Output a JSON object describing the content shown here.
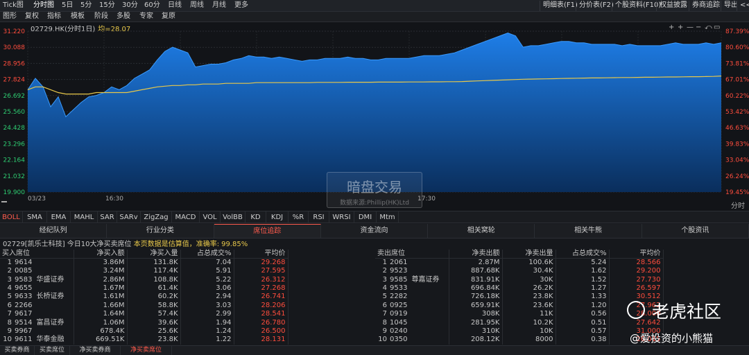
{
  "toolbar1": {
    "tick_label": "Tick图",
    "periods": [
      "分时图",
      "5日",
      "5分",
      "15分",
      "30分",
      "60分",
      "日线",
      "周线",
      "月线",
      "更多"
    ],
    "right_buttons": [
      "明细表(F1)",
      "分价表(F2)",
      "个股资料(F10)",
      "权益披露",
      "券商追踪",
      "导出",
      "<<"
    ]
  },
  "toolbar2": {
    "items": [
      "图形",
      "复权",
      "指标",
      "模板",
      "阶段",
      "多股",
      "专家",
      "复原"
    ]
  },
  "chart": {
    "title": "02729.HK(分时1日)",
    "avg_label": "均=28.07",
    "unit_label": "分时",
    "time_labels": [
      "03/23",
      "16:30",
      "17:30"
    ],
    "chart_data": {
      "type": "area",
      "ylim": [
        19.9,
        31.22
      ],
      "left_ticks": [
        "31.220",
        "30.088",
        "28.956",
        "27.824",
        "26.692",
        "25.560",
        "24.428",
        "23.296",
        "22.164",
        "21.032",
        "19.900"
      ],
      "right_ticks": [
        "87.39%",
        "80.60%",
        "73.81%",
        "67.01%",
        "60.22%",
        "53.42%",
        "46.63%",
        "39.83%",
        "33.04%",
        "26.24%",
        "19.45%"
      ],
      "price": [
        27.1,
        27.9,
        27.3,
        25.9,
        26.6,
        25.2,
        25.7,
        26.2,
        26.6,
        26.7,
        26.9,
        27.3,
        27.1,
        27.4,
        27.9,
        28.2,
        28.5,
        29.2,
        29.8,
        30.1,
        29.9,
        29.7,
        28.7,
        28.8,
        28.9,
        28.9,
        29.0,
        29.2,
        29.3,
        29.5,
        29.4,
        29.4,
        29.3,
        29.4,
        29.3,
        29.2,
        29.1,
        29.2,
        29.2,
        29.3,
        29.3,
        29.3,
        29.4,
        29.3,
        29.3,
        29.2,
        29.2,
        29.3,
        29.3,
        29.3,
        29.3,
        29.4,
        29.5,
        29.5,
        29.5,
        29.6,
        29.7,
        29.9,
        30.1,
        30.3,
        30.5,
        30.7,
        30.9,
        31.1,
        30.9,
        30.1,
        30.2,
        30.2,
        30.3,
        30.4,
        30.5,
        30.5,
        30.4,
        30.4,
        30.3,
        30.3,
        30.3,
        30.3,
        30.2,
        30.3,
        30.2,
        30.2,
        30.2,
        30.2,
        30.3,
        30.4,
        30.3,
        30.3,
        30.3,
        30.4,
        30.3,
        30.4
      ],
      "average": [
        27.1,
        27.3,
        27.3,
        27.1,
        26.9,
        26.8,
        26.8,
        26.8,
        26.8,
        26.9,
        26.9,
        26.9,
        26.9,
        26.9,
        27.0,
        27.1,
        27.2,
        27.3,
        27.35,
        27.4,
        27.4,
        27.45,
        27.45,
        27.5,
        27.5,
        27.5,
        27.55,
        27.55,
        27.55,
        27.55,
        27.6,
        27.6,
        27.6,
        27.6,
        27.6,
        27.6,
        27.6,
        27.6,
        27.62,
        27.62,
        27.62,
        27.62,
        27.63,
        27.63,
        27.63,
        27.63,
        27.64,
        27.64,
        27.64,
        27.64,
        27.65,
        27.65,
        27.65,
        27.66,
        27.66,
        27.67,
        27.67,
        27.68,
        27.7,
        27.72,
        27.74,
        27.76,
        27.78,
        27.8,
        27.82,
        27.84,
        27.85,
        27.86,
        27.87,
        27.88,
        27.89,
        27.9,
        27.91,
        27.92,
        27.93,
        27.93,
        27.94,
        27.95,
        27.96,
        27.96,
        27.97,
        27.98,
        27.98,
        27.99,
        28.0,
        28.0,
        28.01,
        28.02,
        28.02,
        28.03,
        28.04,
        28.07
      ]
    }
  },
  "watermark": {
    "line1": "暗盘交易",
    "line2": "数据来源:Phillip(HK)Ltd"
  },
  "indicators": [
    "BOLL",
    "SMA",
    "EMA",
    "MAHL",
    "SAR",
    "SARv",
    "ZigZag",
    "MACD",
    "VOL",
    "VolBB",
    "KD",
    "KDJ",
    "%R",
    "RSI",
    "WRSI",
    "DMI",
    "Mtm"
  ],
  "tabs": [
    "经纪队列",
    "行业分类",
    "席位追踪",
    "资金流向",
    "相关窝轮",
    "相关牛熊",
    "个股资讯"
  ],
  "info": {
    "prefix": "02729[凯乐士科技]  今日10大净买卖席位 ",
    "note": "本页数据是估算值，准确率:",
    "accuracy": "99.85%"
  },
  "buy_table": {
    "headers": [
      "买入席位",
      "净买入额",
      "净买入量",
      "占总成交%",
      "平均价"
    ],
    "rows": [
      {
        "rank": "1",
        "code": "9614",
        "name": "",
        "amount": "3.86M",
        "volume": "131.8K",
        "pct": "7.04",
        "avg": "29.268"
      },
      {
        "rank": "2",
        "code": "0085",
        "name": "",
        "amount": "3.24M",
        "volume": "117.4K",
        "pct": "5.91",
        "avg": "27.595"
      },
      {
        "rank": "3",
        "code": "9583",
        "name": "华盛证券",
        "amount": "2.86M",
        "volume": "108.8K",
        "pct": "5.22",
        "avg": "26.312"
      },
      {
        "rank": "4",
        "code": "9655",
        "name": "",
        "amount": "1.67M",
        "volume": "61.4K",
        "pct": "3.06",
        "avg": "27.268"
      },
      {
        "rank": "5",
        "code": "9633",
        "name": "长桥证券",
        "amount": "1.61M",
        "volume": "60.2K",
        "pct": "2.94",
        "avg": "26.741"
      },
      {
        "rank": "6",
        "code": "2266",
        "name": "",
        "amount": "1.66M",
        "volume": "58.8K",
        "pct": "3.03",
        "avg": "28.206"
      },
      {
        "rank": "7",
        "code": "9617",
        "name": "",
        "amount": "1.64M",
        "volume": "57.4K",
        "pct": "2.99",
        "avg": "28.541"
      },
      {
        "rank": "8",
        "code": "9514",
        "name": "富昌证券",
        "amount": "1.06M",
        "volume": "39.6K",
        "pct": "1.94",
        "avg": "26.780"
      },
      {
        "rank": "9",
        "code": "9967",
        "name": "",
        "amount": "678.4K",
        "volume": "25.6K",
        "pct": "1.24",
        "avg": "26.500"
      },
      {
        "rank": "10",
        "code": "9611",
        "name": "华泰金融",
        "amount": "669.51K",
        "volume": "23.8K",
        "pct": "1.22",
        "avg": "28.131"
      }
    ]
  },
  "sell_table": {
    "headers": [
      "卖出席位",
      "净卖出额",
      "净卖出量",
      "占总成交%",
      "平均价"
    ],
    "rows": [
      {
        "rank": "1",
        "code": "2061",
        "name": "",
        "amount": "2.87M",
        "volume": "100.6K",
        "pct": "5.24",
        "avg": "28.566"
      },
      {
        "rank": "2",
        "code": "9523",
        "name": "",
        "amount": "887.68K",
        "volume": "30.4K",
        "pct": "1.62",
        "avg": "29.200"
      },
      {
        "rank": "3",
        "code": "9585",
        "name": "尊嘉证券",
        "amount": "831.91K",
        "volume": "30K",
        "pct": "1.52",
        "avg": "27.730"
      },
      {
        "rank": "4",
        "code": "9533",
        "name": "",
        "amount": "696.84K",
        "volume": "26.2K",
        "pct": "1.27",
        "avg": "26.597"
      },
      {
        "rank": "5",
        "code": "2282",
        "name": "",
        "amount": "726.18K",
        "volume": "23.8K",
        "pct": "1.33",
        "avg": "30.512"
      },
      {
        "rank": "6",
        "code": "0925",
        "name": "",
        "amount": "659.91K",
        "volume": "23.6K",
        "pct": "1.20",
        "avg": "27.962"
      },
      {
        "rank": "7",
        "code": "0919",
        "name": "",
        "amount": "308K",
        "volume": "11K",
        "pct": "0.56",
        "avg": "28.000"
      },
      {
        "rank": "8",
        "code": "1045",
        "name": "",
        "amount": "281.95K",
        "volume": "10.2K",
        "pct": "0.51",
        "avg": "27.642"
      },
      {
        "rank": "9",
        "code": "0240",
        "name": "",
        "amount": "310K",
        "volume": "10K",
        "pct": "0.57",
        "avg": "31.000"
      },
      {
        "rank": "10",
        "code": "0350",
        "name": "",
        "amount": "208.12K",
        "volume": "8000",
        "pct": "0.38",
        "avg": "26.015"
      }
    ]
  },
  "bottom_tabs": [
    "买卖券商",
    "买卖席位",
    "净买卖券商",
    "净买卖席位"
  ],
  "brand": {
    "name": "老虎社区",
    "author": "@爱投资的小熊猫"
  },
  "colors": {
    "accent": "#ff5b4d",
    "area_top": "#1e7ee8",
    "area_bottom": "#0a2e5c",
    "avg_line": "#e8c84a",
    "price_up": "#ff4d3d"
  }
}
